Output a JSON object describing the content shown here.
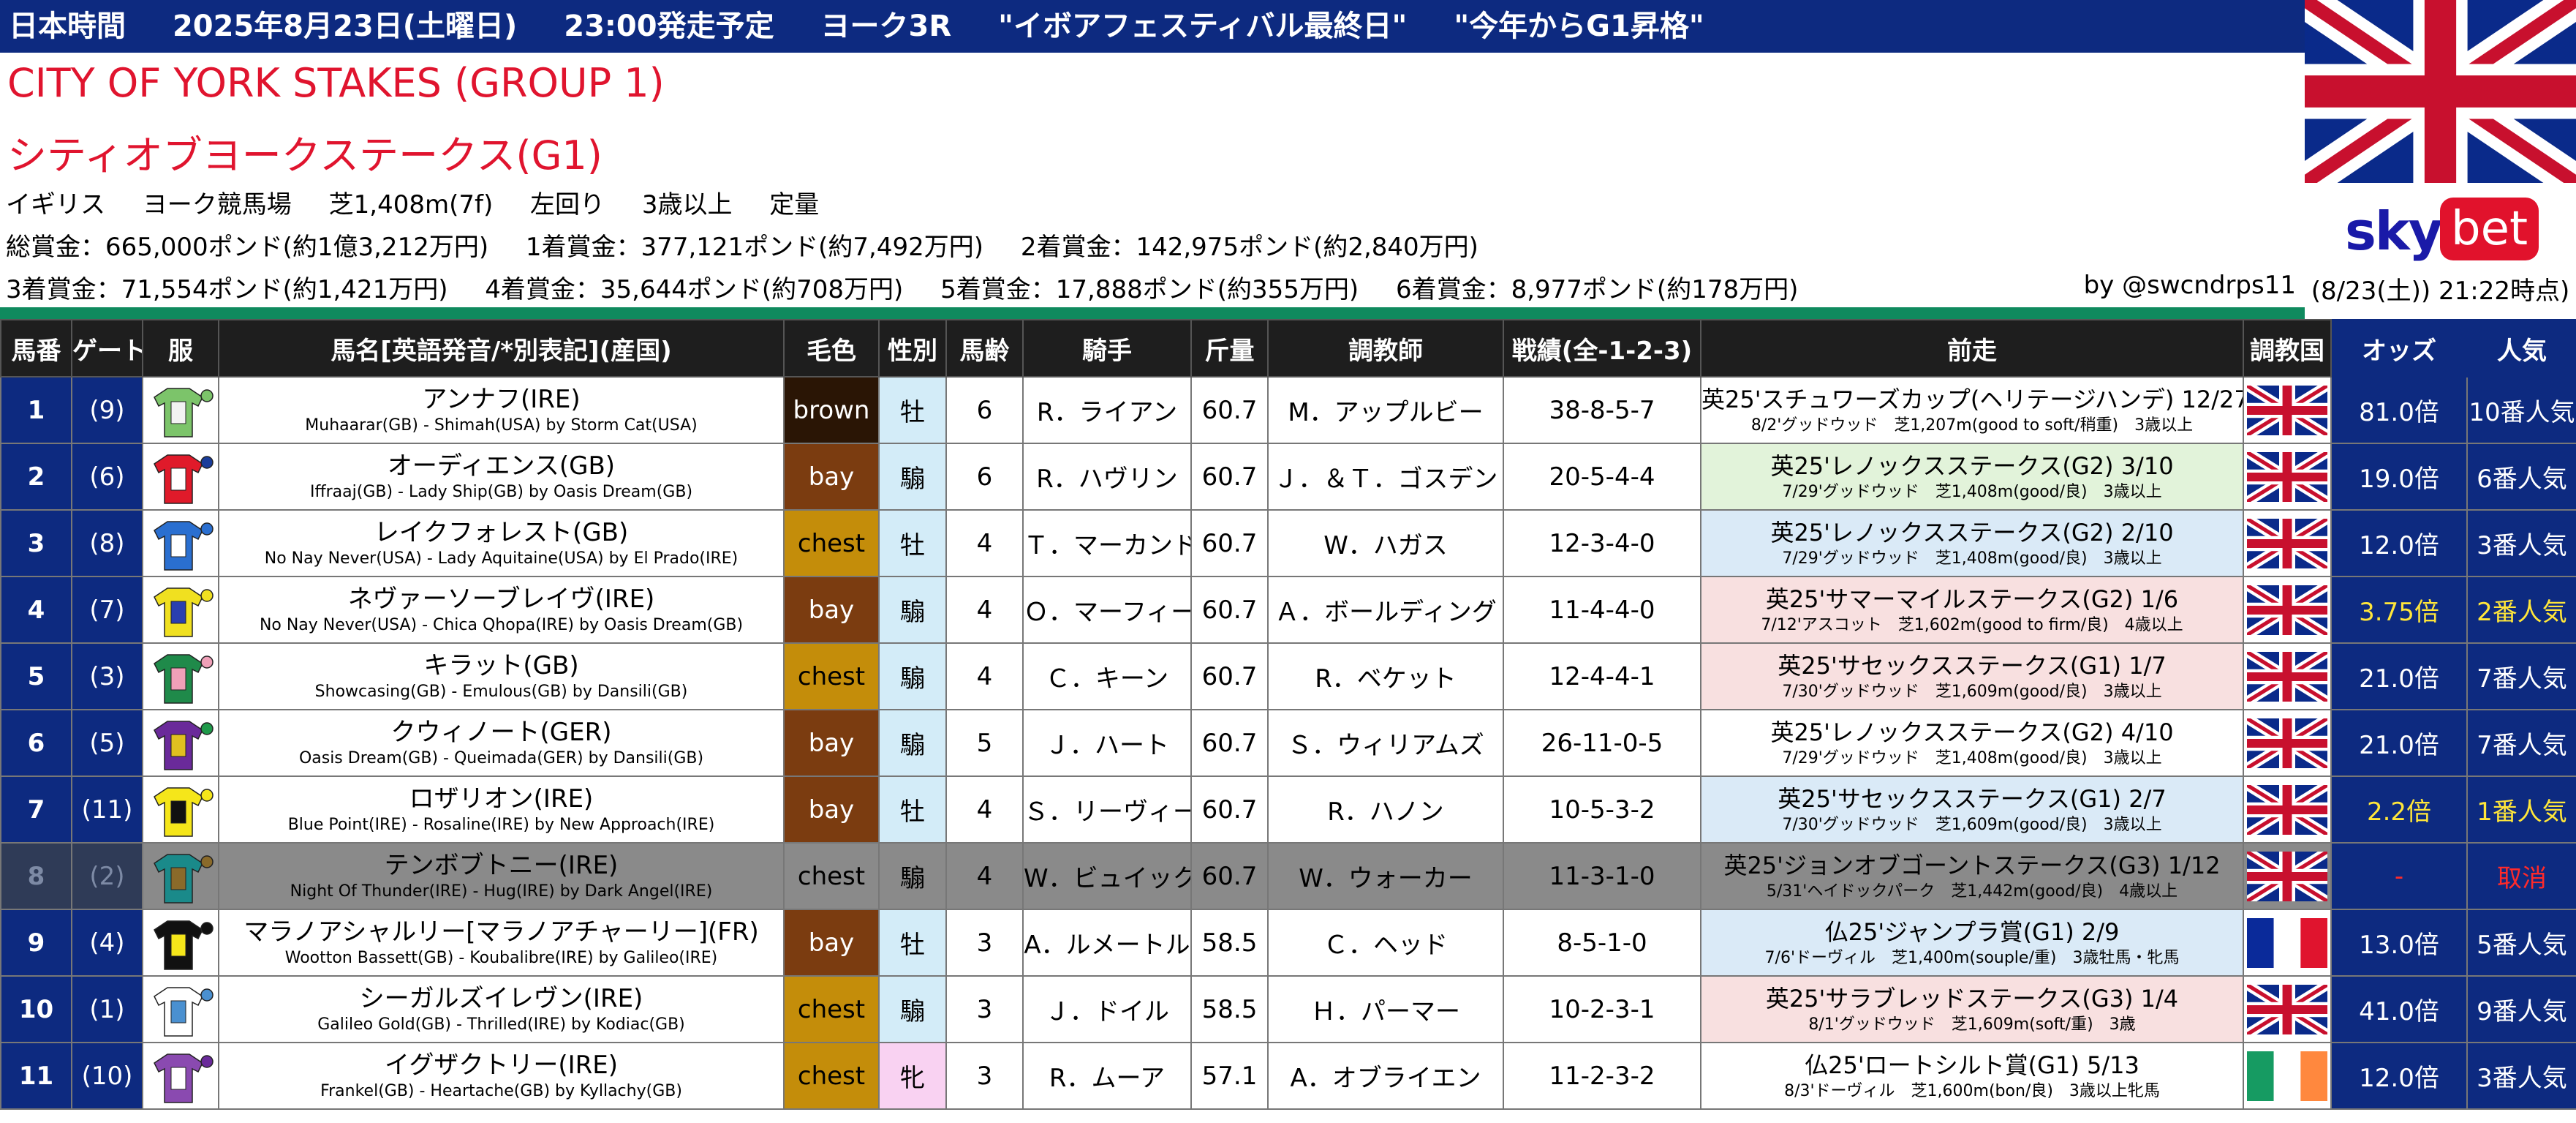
{
  "header": {
    "items": [
      "日本時間",
      "2025年8月23日(土曜日)",
      "23:00発走予定",
      "ヨーク3R",
      "\"イボアフェスティバル最終日\"",
      "\"今年からG1昇格\""
    ]
  },
  "race": {
    "title_en": "CITY OF YORK STAKES (GROUP 1)",
    "title_jp": "シティオブヨークステークス(G1)",
    "conditions": [
      "イギリス",
      "ヨーク競馬場",
      "芝1,408m(7f)",
      "左回り",
      "3歳以上",
      "定量"
    ],
    "prizes_line1": [
      "総賞金：665,000ポンド(約1億3,212万円)",
      "1着賞金：377,121ポンド(約7,492万円)",
      "2着賞金：142,975ポンド(約2,840万円)"
    ],
    "prizes_line2": [
      "3着賞金：71,554ポンド(約1,421万円)",
      "4着賞金：35,644ポンド(約708万円)",
      "5着賞金：17,888ポンド(約355万円)",
      "6着賞金：8,977ポンド(約178万円)"
    ],
    "byline": "by @swcndrps11"
  },
  "sponsor": {
    "sky": "sky",
    "bet": "bet",
    "as_of": "(8/23(土)) 21:22時点)"
  },
  "columns": [
    "馬番",
    "ゲート",
    "服",
    "馬名[英語発音/*別表記](産国)",
    "毛色",
    "性別",
    "馬齢",
    "騎手",
    "斤量",
    "調教師",
    "戦績(全-1-2-3)",
    "前走",
    "調教国",
    "オッズ",
    "人気"
  ],
  "colors": {
    "navy": "#0d2a80",
    "red": "#e0142e",
    "green_bar": "#0f8a5e",
    "yellow": "#ffe63a"
  },
  "runners": [
    {
      "num": "1",
      "gate": "(9)",
      "name": "アンナフ(IRE)",
      "pedigree": "Muhaarar(GB) - Shimah(USA) by Storm Cat(USA)",
      "coat": "brown",
      "sex": "牡",
      "age": "6",
      "jockey": "R．ライアン",
      "weight": "60.7",
      "trainer": "M．アップルビー",
      "record": "38-8-5-7",
      "prev_race": "英25'スチュワーズカップ(ヘリテージハンデ) 12/27",
      "prev_detail": "8/2'グッドウッド　芝1,207m(good to soft/稍重)　3歳以上",
      "country": "GB",
      "odds": "81.0倍",
      "pop": "10番人気",
      "silk": [
        "#7cc46a",
        "#f2f2f2",
        "#7cc46a"
      ]
    },
    {
      "num": "2",
      "gate": "(6)",
      "name": "オーディエンス(GB)",
      "pedigree": "Iffraaj(GB) - Lady Ship(GB) by Oasis Dream(GB)",
      "coat": "bay",
      "sex": "騸",
      "age": "6",
      "jockey": "R．ハヴリン",
      "weight": "60.7",
      "trainer": "Ｊ．＆Ｔ．ゴスデン",
      "record": "20-5-4-4",
      "prev_race": "英25'レノックスステークス(G2) 3/10",
      "prev_detail": "7/29'グッドウッド　芝1,408m(good/良)　3歳以上",
      "country": "GB",
      "odds": "19.0倍",
      "pop": "6番人気",
      "silk": [
        "#e01a2a",
        "#ffffff",
        "#1a3c9a"
      ]
    },
    {
      "num": "3",
      "gate": "(8)",
      "name": "レイクフォレスト(GB)",
      "pedigree": "No Nay Never(USA) - Lady Aquitaine(USA) by El Prado(IRE)",
      "coat": "chest",
      "sex": "牡",
      "age": "4",
      "jockey": "Ｔ．マーカンド",
      "weight": "60.7",
      "trainer": "W．ハガス",
      "record": "12-3-4-0",
      "prev_race": "英25'レノックスステークス(G2) 2/10",
      "prev_detail": "7/29'グッドウッド　芝1,408m(good/良)　3歳以上",
      "country": "GB",
      "odds": "12.0倍",
      "pop": "3番人気",
      "silk": [
        "#2a6fd0",
        "#ffffff",
        "#2a6fd0"
      ]
    },
    {
      "num": "4",
      "gate": "(7)",
      "name": "ネヴァーソーブレイヴ(IRE)",
      "pedigree": "No Nay Never(USA) - Chica Qhopa(IRE) by Oasis Dream(GB)",
      "coat": "bay",
      "sex": "騸",
      "age": "4",
      "jockey": "Ｏ．マーフィー",
      "weight": "60.7",
      "trainer": "Ａ．ボールディング",
      "record": "11-4-4-0",
      "prev_race": "英25'サマーマイルステークス(G2) 1/6",
      "prev_detail": "7/12'アスコット　芝1,602m(good to firm/良)　4歳以上",
      "country": "GB",
      "odds": "3.75倍",
      "pop": "2番人気",
      "silk": [
        "#f0e020",
        "#2a3fb0",
        "#f0e020"
      ]
    },
    {
      "num": "5",
      "gate": "(3)",
      "name": "キラット(GB)",
      "pedigree": "Showcasing(GB) - Emulous(GB) by Dansili(GB)",
      "coat": "chest",
      "sex": "騸",
      "age": "4",
      "jockey": "Ｃ．キーン",
      "weight": "60.7",
      "trainer": "R．ベケット",
      "record": "12-4-4-1",
      "prev_race": "英25'サセックスステークス(G1) 1/7",
      "prev_detail": "7/30'グッドウッド　芝1,609m(good/良)　3歳以上",
      "country": "GB",
      "odds": "21.0倍",
      "pop": "7番人気",
      "silk": [
        "#1f8a4a",
        "#f0a0b8",
        "#f0a0b8"
      ]
    },
    {
      "num": "6",
      "gate": "(5)",
      "name": "クウィノート(GER)",
      "pedigree": "Oasis Dream(GB) - Queimada(GER) by Dansili(GB)",
      "coat": "bay",
      "sex": "騸",
      "age": "5",
      "jockey": "Ｊ．ハート",
      "weight": "60.7",
      "trainer": "Ｓ．ウィリアムズ",
      "record": "26-11-0-5",
      "prev_race": "英25'レノックスステークス(G2) 4/10",
      "prev_detail": "7/29'グッドウッド　芝1,408m(good/良)　3歳以上",
      "country": "GB",
      "odds": "21.0倍",
      "pop": "7番人気",
      "silk": [
        "#6a2a9a",
        "#e0c020",
        "#1f9a4a"
      ]
    },
    {
      "num": "7",
      "gate": "(11)",
      "name": "ロザリオン(IRE)",
      "pedigree": "Blue Point(IRE) - Rosaline(IRE) by New Approach(IRE)",
      "coat": "bay",
      "sex": "牡",
      "age": "4",
      "jockey": "Ｓ．リーヴィー",
      "weight": "60.7",
      "trainer": "R．ハノン",
      "record": "10-5-3-2",
      "prev_race": "英25'サセックスステークス(G1) 2/7",
      "prev_detail": "7/30'グッドウッド　芝1,609m(good/良)　3歳以上",
      "country": "GB",
      "odds": "2.2倍",
      "pop": "1番人気",
      "silk": [
        "#f5e61a",
        "#111111",
        "#f5e61a"
      ]
    },
    {
      "num": "8",
      "gate": "(2)",
      "name": "テンボブトニー(IRE)",
      "pedigree": "Night Of Thunder(IRE) - Hug(IRE) by Dark Angel(IRE)",
      "coat": "chest",
      "sex": "騸",
      "age": "4",
      "jockey": "W．ビュイック",
      "weight": "60.7",
      "trainer": "W．ウォーカー",
      "record": "11-3-1-0",
      "prev_race": "英25'ジョンオブゴーントステークス(G3) 1/12",
      "prev_detail": "5/31'ヘイドックパーク　芝1,442m(good/良)　4歳以上",
      "country": "GB",
      "odds": "-",
      "pop": "取消",
      "silk": [
        "#1a8a8a",
        "#8a6a2a",
        "#8a6a2a"
      ]
    },
    {
      "num": "9",
      "gate": "(4)",
      "name": "マラノアシャルリー[マラノアチャーリー](FR)",
      "pedigree": "Wootton Bassett(GB) - Koubalibre(IRE) by Galileo(IRE)",
      "coat": "bay",
      "sex": "牡",
      "age": "3",
      "jockey": "A．ルメートル",
      "weight": "58.5",
      "trainer": "Ｃ．ヘッド",
      "record": "8-5-1-0",
      "prev_race": "仏25'ジャンプラ賞(G1) 2/9",
      "prev_detail": "7/6'ドーヴィル　芝1,400m(souple/重)　3歳牡馬・牝馬",
      "country": "FR",
      "odds": "13.0倍",
      "pop": "5番人気",
      "silk": [
        "#111111",
        "#f5e61a",
        "#111111"
      ]
    },
    {
      "num": "10",
      "gate": "(1)",
      "name": "シーガルズイレヴン(IRE)",
      "pedigree": "Galileo Gold(GB) - Thrilled(IRE) by Kodiac(GB)",
      "coat": "chest",
      "sex": "騸",
      "age": "3",
      "jockey": "Ｊ．ドイル",
      "weight": "58.5",
      "trainer": "Ｈ．パーマー",
      "record": "10-2-3-1",
      "prev_race": "英25'サラブレッドステークス(G3) 1/4",
      "prev_detail": "8/1'グッドウッド　芝1,609m(soft/重)　3歳",
      "country": "GB",
      "odds": "41.0倍",
      "pop": "9番人気",
      "silk": [
        "#ffffff",
        "#4a90d0",
        "#4a90d0"
      ]
    },
    {
      "num": "11",
      "gate": "(10)",
      "name": "イグザクトリー(IRE)",
      "pedigree": "Frankel(GB) - Heartache(GB) by Kyllachy(GB)",
      "coat": "chest",
      "sex": "牝",
      "age": "3",
      "jockey": "R．ムーア",
      "weight": "57.1",
      "trainer": "A．オブライエン",
      "record": "11-2-3-2",
      "prev_race": "仏25'ロートシルト賞(G1) 5/13",
      "prev_detail": "8/3'ドーヴィル　芝1,600m(bon/良)　3歳以上牝馬",
      "country": "IE",
      "odds": "12.0倍",
      "pop": "3番人気",
      "silk": [
        "#8a4ab0",
        "#ffffff",
        "#6a2a9a"
      ]
    }
  ]
}
